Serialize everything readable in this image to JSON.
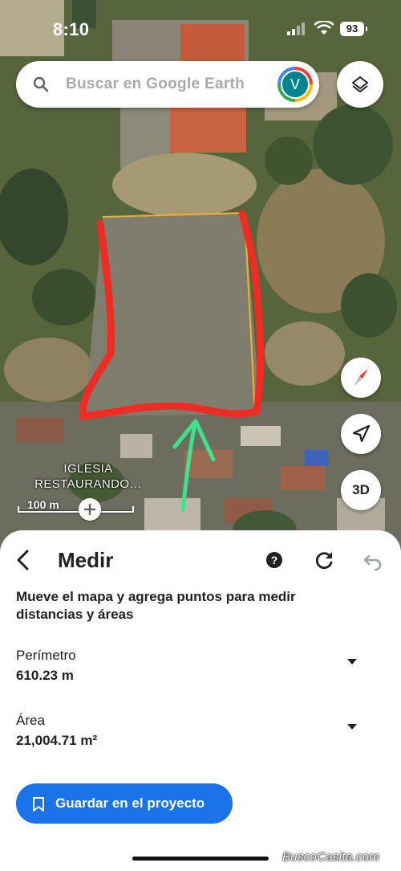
{
  "status_bar": {
    "time": "8:10",
    "battery": "93"
  },
  "search": {
    "placeholder": "Buscar en Google Earth",
    "avatar_initial": "V"
  },
  "map": {
    "place_label": "IGLESIA RESTAURANDO…",
    "scale_label": "100 m",
    "map_controls": {
      "three_d_label": "3D"
    },
    "colors": {
      "polygon_outline": "#ef2b24",
      "arrow": "#3ee28c",
      "edge_line": "#f2b134"
    }
  },
  "sheet": {
    "title": "Medir",
    "instruction": "Mueve el mapa y agrega puntos para medir distancias y áreas",
    "perimeter": {
      "label": "Perímetro",
      "value": "610.23 m"
    },
    "area": {
      "label": "Área",
      "value": "21,004.71 m²"
    },
    "save_label": "Guardar en el proyecto",
    "accent": "#1a73e8"
  },
  "watermark": "BuscoCasita.com",
  "icons": [
    "search-icon",
    "layers-icon",
    "compass-icon",
    "locate-icon",
    "back-icon",
    "help-icon",
    "redo-icon",
    "undo-icon",
    "chevron-down-icon",
    "bookmark-icon",
    "add-point-icon"
  ]
}
